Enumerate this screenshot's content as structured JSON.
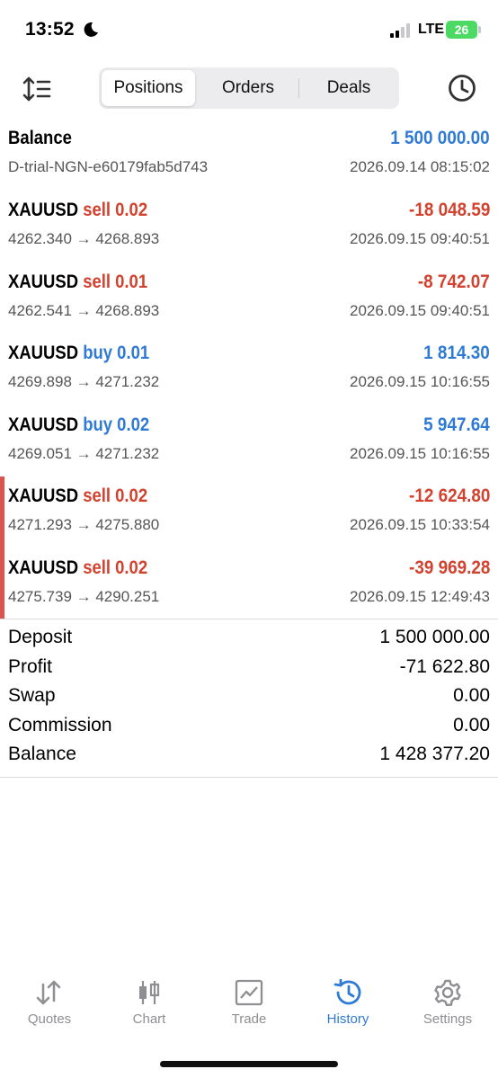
{
  "status": {
    "time": "13:52",
    "network": "LTE",
    "battery": "26"
  },
  "tabs": {
    "positions": "Positions",
    "orders": "Orders",
    "deals": "Deals",
    "active": "Positions"
  },
  "balance_header": {
    "title": "Balance",
    "amount": "1 500 000.00",
    "account": "D-trial-NGN-e60179fab5d743",
    "datetime": "2026.09.14 08:15:02"
  },
  "positions": [
    {
      "symbol": "XAUUSD",
      "side": "sell 0.02",
      "profit": "-18 048.59",
      "prices": "4262.340 → 4268.893",
      "datetime": "2026.09.15 09:40:51",
      "direction": "sell"
    },
    {
      "symbol": "XAUUSD",
      "side": "sell 0.01",
      "profit": "-8 742.07",
      "prices": "4262.541 → 4268.893",
      "datetime": "2026.09.15 09:40:51",
      "direction": "sell"
    },
    {
      "symbol": "XAUUSD",
      "side": "buy 0.01",
      "profit": "1 814.30",
      "prices": "4269.898 → 4271.232",
      "datetime": "2026.09.15 10:16:55",
      "direction": "buy"
    },
    {
      "symbol": "XAUUSD",
      "side": "buy 0.02",
      "profit": "5 947.64",
      "prices": "4269.051 → 4271.232",
      "datetime": "2026.09.15 10:16:55",
      "direction": "buy"
    },
    {
      "symbol": "XAUUSD",
      "side": "sell 0.02",
      "profit": "-12 624.80",
      "prices": "4271.293 → 4275.880",
      "datetime": "2026.09.15 10:33:54",
      "direction": "sell"
    },
    {
      "symbol": "XAUUSD",
      "side": "sell 0.02",
      "profit": "-39 969.28",
      "prices": "4275.739 → 4290.251",
      "datetime": "2026.09.15 12:49:43",
      "direction": "sell"
    }
  ],
  "summary": [
    {
      "label": "Deposit",
      "value": "1 500 000.00"
    },
    {
      "label": "Profit",
      "value": "-71 622.80"
    },
    {
      "label": "Swap",
      "value": "0.00"
    },
    {
      "label": "Commission",
      "value": "0.00"
    },
    {
      "label": "Balance",
      "value": "1 428 377.20"
    }
  ],
  "tabbar": {
    "items": [
      {
        "label": "Quotes",
        "icon": "quotes-icon"
      },
      {
        "label": "Chart",
        "icon": "chart-icon"
      },
      {
        "label": "Trade",
        "icon": "trade-icon"
      },
      {
        "label": "History",
        "icon": "history-icon"
      },
      {
        "label": "Settings",
        "icon": "settings-icon"
      }
    ],
    "active": "History"
  },
  "colors": {
    "buy": "#2f7ad4",
    "sell": "#d2422f",
    "accent": "#2f7ad4",
    "inactive": "#8e8e93"
  }
}
